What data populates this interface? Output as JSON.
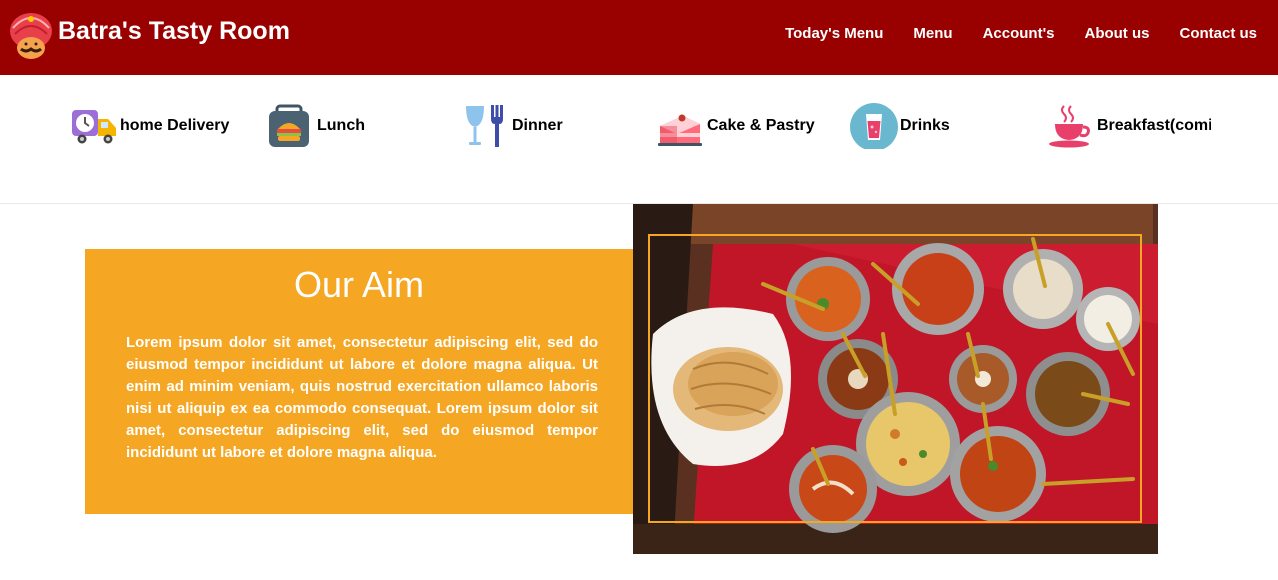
{
  "header": {
    "brand": "Batra's Tasty Room",
    "nav": [
      {
        "label": "Today's Menu"
      },
      {
        "label": "Menu"
      },
      {
        "label": "Account's"
      },
      {
        "label": "About us"
      },
      {
        "label": "Contact us"
      }
    ]
  },
  "categories": [
    {
      "label": "home Delivery",
      "icon": "delivery-truck-icon"
    },
    {
      "label": "Lunch",
      "icon": "lunchbox-icon"
    },
    {
      "label": "Dinner",
      "icon": "wineglass-fork-icon"
    },
    {
      "label": "Cake & Pastry",
      "icon": "cake-icon"
    },
    {
      "label": "Drinks",
      "icon": "drink-glass-icon"
    },
    {
      "label": "Breakfast(comi",
      "icon": "coffee-cup-icon"
    }
  ],
  "aim": {
    "title": "Our Aim",
    "text": "Lorem ipsum dolor sit amet, consectetur adipiscing elit, sed do eiusmod tempor incididunt ut labore et dolore magna aliqua. Ut enim ad minim veniam, quis nostrud exercitation ullamco laboris nisi ut aliquip ex ea commodo consequat. Lorem ipsum dolor sit amet, consectetur adipiscing elit, sed do eiusmod tempor incididunt ut labore et dolore magna aliqua."
  },
  "colors": {
    "header_bg": "#990000",
    "aim_bg": "#f5a623",
    "photo_frame": "#f5a623"
  }
}
